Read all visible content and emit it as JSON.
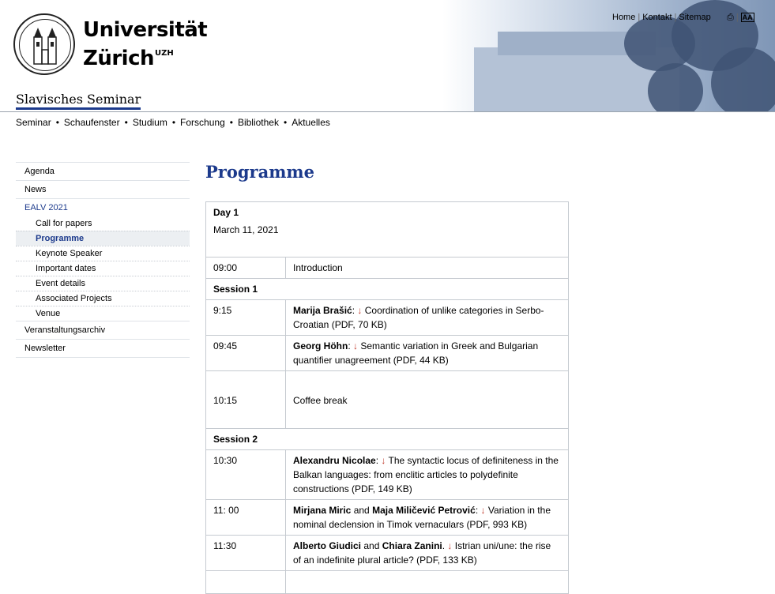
{
  "header": {
    "university_line1": "Universität",
    "university_line2": "Zürich",
    "university_sup": "UZH",
    "site_title": "Slavisches Seminar"
  },
  "service_nav": [
    "Home",
    "Kontakt",
    "Sitemap"
  ],
  "main_nav": [
    "Seminar",
    "Schaufenster",
    "Studium",
    "Forschung",
    "Bibliothek",
    "Aktuelles"
  ],
  "sidebar": {
    "items": [
      {
        "label": "Agenda"
      },
      {
        "label": "News"
      },
      {
        "label": "EALV 2021"
      }
    ],
    "subitems": [
      {
        "label": "Call for papers"
      },
      {
        "label": "Programme"
      },
      {
        "label": "Keynote Speaker"
      },
      {
        "label": "Important dates"
      },
      {
        "label": "Event details"
      },
      {
        "label": "Associated Projects"
      },
      {
        "label": "Venue"
      }
    ],
    "after": [
      {
        "label": "Veranstaltungsarchiv"
      },
      {
        "label": "Newsletter"
      }
    ]
  },
  "page_title": "Programme",
  "programme": {
    "day": "Day 1",
    "date": "March 11, 2021",
    "intro": {
      "time": "09:00",
      "label": "Introduction"
    },
    "session1": "Session 1",
    "s1": [
      {
        "time": "9:15",
        "author": "Marija Brašić",
        "title": "Coordination of unlike categories in Serbo-Croatian (PDF, 70 KB)"
      },
      {
        "time": "09:45",
        "author": "Georg Höhn",
        "title": "Semantic variation in Greek and Bulgarian quantifier unagreement (PDF, 44 KB)"
      }
    ],
    "coffee": {
      "time": "10:15",
      "label": "Coffee break"
    },
    "session2": "Session 2",
    "s2a": {
      "time": "10:30",
      "author": "Alexandru Nicolae",
      "title": "The syntactic locus of definiteness in the Balkan languages: from enclitic articles to polydefinite constructions (PDF, 149 KB)"
    },
    "s2b": {
      "time": "11: 00",
      "author1": "Mirjana Miric",
      "and": "and",
      "author2": "Maja Miličević Petrović",
      "title": "Variation in the nominal declension in Timok vernaculars (PDF, 993 KB)"
    },
    "s2c": {
      "time": "11:30",
      "author1": "Alberto Giudici",
      "and": "and",
      "author2": "Chiara Zanini",
      "title": "Istrian uni/une: the rise of an indefinite plural article? (PDF, 133 KB)"
    }
  }
}
